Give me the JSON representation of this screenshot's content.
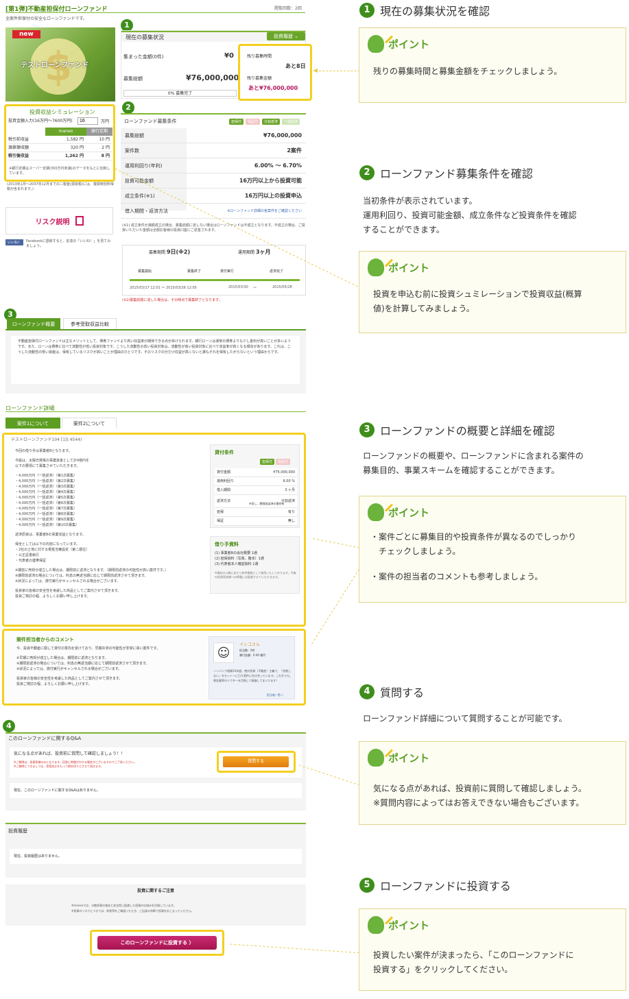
{
  "page": {
    "title": "[第1弾]不動産担保付ローンファンド",
    "view_label": "閲覧回数：2回",
    "subtitle": "全案件担保付の安全なローンファンドです。"
  },
  "hero": {
    "badge": "new",
    "image_text": "テストローンファンド"
  },
  "status": {
    "header": "現在の募集状況",
    "history_btn": "投資履歴",
    "collected_label": "集まった金額(0件)",
    "collected_value": "¥0",
    "total_label": "募集総額",
    "total_value": "¥76,000,000",
    "progress_text": "0% 募集完了",
    "remain_time_label": "残り募集時間",
    "remain_time_value": "あと8日",
    "remain_amount_label": "残り募集金額",
    "remain_amount_value": "あと¥76,000,000"
  },
  "sim": {
    "title": "投資収益シミュレーション",
    "input_label": "投資金額入力(16万円〜7600万円)",
    "input_value": "16",
    "unit": "万円",
    "col_maneo": "maneo",
    "col_bank": "銀行定期",
    "rows": [
      {
        "label": "税引前収益",
        "maneo": "1,582 円",
        "bank": "10 円"
      },
      {
        "label": "源泉徴収額",
        "maneo": "320 円",
        "bank": "2 円"
      },
      {
        "label": "税引後収益",
        "maneo": "1,262 円",
        "bank": "8 円"
      }
    ],
    "note": "※銀行定期はスーパー定期(300万円未満)のデータをもとに比較しています。",
    "note2": "(2013年1月〜2037年12月までの二税金(源泉税)には、復興特別所得税が含まれます。)"
  },
  "risk": {
    "label": "リスク説明"
  },
  "facebook": {
    "label": "いいね！",
    "text": "Facebookに登録すると、友達の「いいね！」を見てみましょう。"
  },
  "conditions": {
    "header": "ローンファンド募集条件",
    "tags": [
      "担保付",
      "保証付",
      "分割返済",
      "一括返済"
    ],
    "rows": [
      {
        "label": "募集総額",
        "value": "¥76,000,000"
      },
      {
        "label": "案件数",
        "value": "2案件"
      },
      {
        "label": "運用利回り(年利)",
        "value": "6.00% 〜 6.70%"
      },
      {
        "label": "投資可能金額",
        "value": "16万円以上から投資可能"
      },
      {
        "label": "成立条件(※1)",
        "value": "16万円以上の投資申込"
      },
      {
        "label": "借入期間・返済方法",
        "value": "※ローンファンド詳細の各案件をご確認ください"
      }
    ],
    "note": "(※1) 成立条件が満額成立の場合、募集総額に達しない場合はローンファンドは不成立となります。不成立の場合、ご投資いただいた金額は全額お客様の投資口座にご返金されます。"
  },
  "timeline": {
    "period_label": "募集期間",
    "period_value": "9日(※2)",
    "op_label": "運用期間",
    "op_value": "3ヶ月",
    "steps": [
      "募集開始",
      "募集終了",
      "貸付実行",
      "返済完了"
    ],
    "dates": [
      "2015/03/17 12:01 〜 2015/03/26 12:05",
      "2015/03/30",
      "〜",
      "2015/05/28"
    ],
    "note": "(※2)募集総額に達した場合は、その時点で募集終了となります。"
  },
  "overview": {
    "tabs": [
      "ローンファンド概要",
      "参考受取収益比較"
    ],
    "text": "不動産担保付ローンファンドは主なメリットとして、債券ファンドより高い収益率が期待できる点があげられます。銀行ローンは通常の債券よりも少し金利が高いことが多いようです。また、ローンは債券に比べて流動性が低い投資対象です。こうした流動性の低い投資対象は、流動性が高い投資対象に比べて収益率が高くなる傾向があります。これは、こうした流動性の低い資産は、保有しているリスクが高いことが理由のひとつです。そのリスクの分だけ収益が高くないと誰もそれを保有したがらないという理由からです。"
  },
  "detail": {
    "title": "ローンファンド詳細",
    "tabs": [
      "案件1について",
      "案件2について"
    ],
    "case_id": "テストローンファンド104 [1](:4544)",
    "lines": [
      "今回の借り手は事業者Bとなります。",
      "今般は、太陽光発電の事業資金として計4億円を",
      "以下の要領にて募集させていただきます。",
      "・4,000万円（一括返済）（第1次募集）",
      "・4,000万円（一括返済）（第2次募集）",
      "・4,000万円（一括返済）（第3次募集）",
      "・4,000万円（一括返済）（第4次募集）",
      "・4,000万円（一括返済）（第5次募集）",
      "・4,000万円（一括返済）（第6次募集）",
      "・4,000万円（一括返済）（第7次募集）",
      "・4,000万円（一括返済）（第8次募集）",
      "・4,000万円（一括返済）（第9次募集）",
      "・4,000万円（一括返済）（第10次募集）",
      "返済原資は、事業者Bの事業収益となります。",
      "保全としては以下の内容になっています。",
      "・2社の土地に対する根抵当権設定（第二順位）",
      "・公正証書執行",
      "・代表者の連帯保証",
      "※期前に売却が成立した場合は、期限前に返済となります。（期限前返済の可能性が高い案件です。）",
      "※期限前返済の場合については、利息の無返当期に応じて期限前返済させて頂きます。",
      "※状況によっては、貸付実行がキャンセルされる場合がございます。",
      "投資家の皆様の安全性を考慮した商品としてご案内させて頂きます。",
      "投資ご検討の程、よろしくお願い申し上げます。"
    ],
    "loan_title": "貸付条件",
    "loan_tags": [
      "担保付",
      "保証付"
    ],
    "loan_rows": [
      {
        "label": "貸付金額",
        "value": "¥75,000,000"
      },
      {
        "label": "運用利回り",
        "value": "6.00 %"
      },
      {
        "label": "借入期間",
        "value": "3 ヶ月"
      },
      {
        "label": "返済方法",
        "value": "分割返済"
      },
      {
        "label": "担保",
        "value": "有り"
      },
      {
        "label": "保証",
        "value": "無し"
      }
    ],
    "repay_note": "※但し、期限前返済の場合有",
    "docs_title": "借り手資料",
    "docs": [
      "(1) 事業者Bの会社概要 1通",
      "(2) 担保資料（写真、謄本）1通",
      "(3) 代表者本人確認資料 1通"
    ],
    "docs_note": "※資料の公開にあたり参考情報として使用いたしております。今後の投資家皆様への掲載には配慮させていただきます。"
  },
  "comment": {
    "title": "案件担当者からのコメント",
    "lines": [
      "今、投資不動産に関して貸付の意向を受けており、早期弁済の可能性が非常に高い案件です。",
      "※早期に売却が成立した場合は、期限前に返済となります。",
      "※期限前返済の場合については、利息の無返当期に応じて期限前返済させて頂きます。",
      "※状況によっては、貸付実行がキャンセルされる場合がございます。",
      "投資家の皆様の安全性を考慮した商品としてご案内させて頂きます。",
      "投資ご検討の程、よろしくお願い申し上げます。"
    ],
    "staff_name": "イシコさん",
    "staff_info1": "担当数：0件",
    "staff_info2": "貸付金額：0.00 億円",
    "staff_text": "ノンバンク経験10年超。絶対投資（不動産）主義で、「失敗しない」をモットーに日々案件に向き合っています。これからも、資金業界のドクターを目指して精進してまいります！",
    "staff_link": "担当者一覧へ"
  },
  "qa": {
    "header": "このローンファンドに関するQ&A",
    "text": "気になる点があれば、投資前に質問して確認しましょう！！",
    "warn1": "※ご質問は、投資家様のみとなります。回答に時間がかかる場合がございますのでご了承ください。",
    "warn2": "※ご質問につきましては、答案成立をもって締め切りとさせて頂きます。",
    "btn": "質問する",
    "empty": "現在、このローンファンドに関するQ&Aはありません。"
  },
  "history": {
    "header": "投資履歴",
    "empty": "現在、投資履歴はありません。"
  },
  "caution": {
    "title": "投資に関するご注意",
    "line1": "※maneoでは、分散投資の強化と安全性に配慮した投資の仕組みを目指しています。",
    "line2": "※投資のリスクにつきては、約款等をご確認いただき、ご自身の判断で投資をおこなってください。"
  },
  "invest_btn": "このローンファンドに投資する",
  "guide": {
    "point_label": "ポイント",
    "sections": [
      {
        "num": "1",
        "title": "現在の募集状況を確認",
        "desc": [],
        "point": [
          "残りの募集時間と募集金額をチェックしましょう。"
        ]
      },
      {
        "num": "2",
        "title": "ローンファンド募集条件を確認",
        "desc": [
          "当初条件が表示されています。",
          "運用利回り、投資可能金額、成立条件など投資条件を確認",
          "することができます。"
        ],
        "point": [
          "投資を申込む前に投資シュミレーションで投資収益(概算",
          "値)を計算してみましょう。"
        ]
      },
      {
        "num": "3",
        "title": "ローンファンドの概要と詳細を確認",
        "desc": [
          "ローンファンドの概要や、ローンファンドに含まれる案件の",
          "募集目的、事業スキームを確認することができます。"
        ],
        "point": [
          "・案件ごとに募集目的や投資条件が異なるのでしっかり",
          "　チェックしましょう。",
          "・案件の担当者のコメントも参考しましょう。"
        ]
      },
      {
        "num": "4",
        "title": "質問する",
        "desc": [
          "ローンファンド詳細について質問することが可能です。"
        ],
        "point": [
          "気になる点があれば、投資前に質問して確認しましょう。",
          "※質問内容によってはお答えできない場合もございます。"
        ]
      },
      {
        "num": "5",
        "title": "ローンファンドに投資する",
        "desc": [],
        "point": [
          "投資したい案件が決まったら、「このローンファンドに",
          "投資する」をクリックしてください。"
        ]
      }
    ]
  },
  "colors": {
    "green": "#3f8e1c",
    "yellow": "#f3cf1f",
    "magenta": "#b5175e"
  }
}
